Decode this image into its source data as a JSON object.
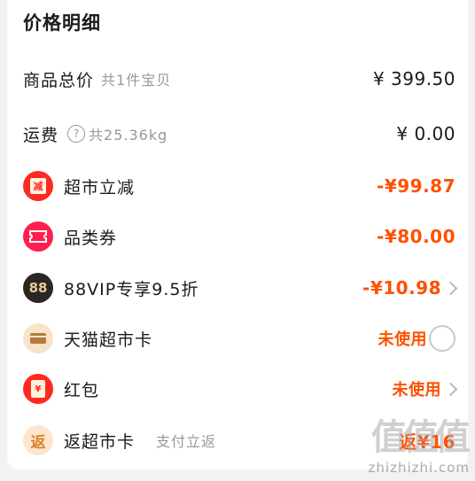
{
  "section_title": "价格明细",
  "rows": {
    "total": {
      "label": "商品总价",
      "sub": "共1件宝贝",
      "amount": "¥ 399.50"
    },
    "shipping": {
      "label": "运费",
      "help": "?",
      "sub": "共25.36kg",
      "amount": "¥ 0.00"
    },
    "supermarket_discount": {
      "label": "超市立减",
      "icon_text": "减",
      "amount": "-¥99.87"
    },
    "category_coupon": {
      "label": "品类券",
      "amount": "-¥80.00"
    },
    "vip": {
      "label": "88VIP专享9.5折",
      "icon_text": "88",
      "amount": "-¥10.98"
    },
    "tmall_card": {
      "label": "天猫超市卡",
      "status": "未使用"
    },
    "red_packet": {
      "label": "红包",
      "icon_text": "¥",
      "status": "未使用"
    },
    "rebate_card": {
      "label": "返超市卡",
      "icon_text": "返",
      "sub": "支付立返",
      "amount": "返¥16"
    }
  },
  "icons": {
    "supermarket_discount": "discount-envelope-icon",
    "category_coupon": "coupon-ticket-icon",
    "vip": "vip-88-icon",
    "tmall_card": "card-icon",
    "red_packet": "red-packet-icon",
    "rebate_card": "rebate-icon"
  },
  "colors": {
    "accent": "#ff5000",
    "muted": "#999999"
  },
  "watermark": {
    "glyphs": "值值值",
    "text": "zhizhizhi.com"
  }
}
